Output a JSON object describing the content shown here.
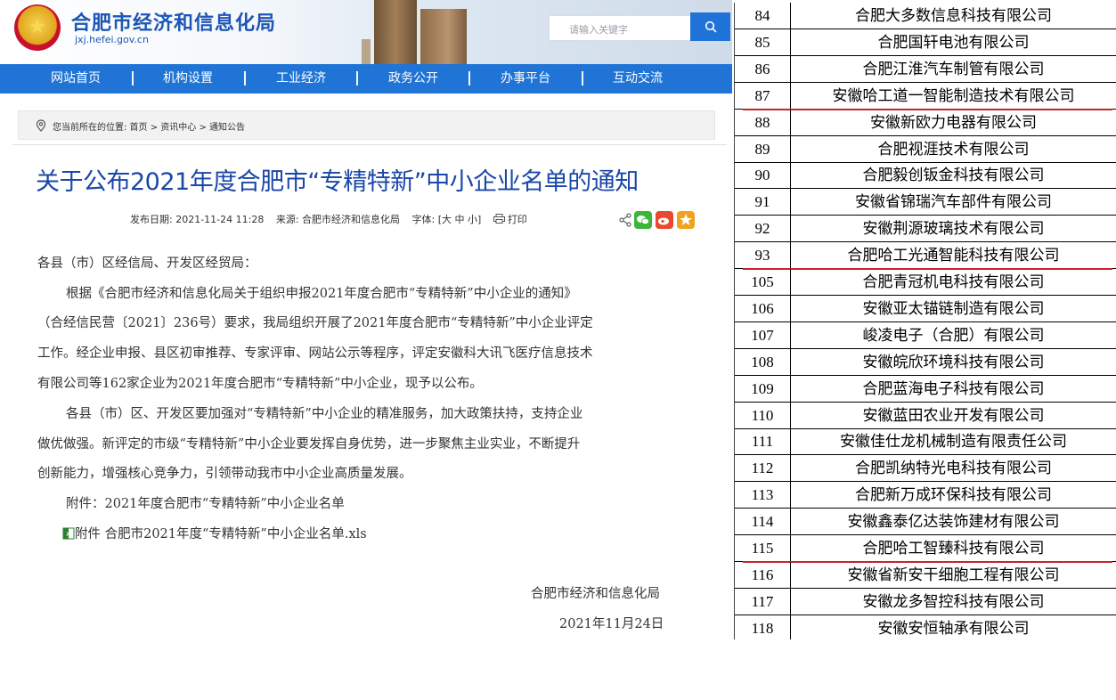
{
  "header": {
    "site_title": "合肥市经济和信息化局",
    "site_domain": "jxj.hefei.gov.cn",
    "search_placeholder": "请输入关键字"
  },
  "nav": {
    "items": [
      "网站首页",
      "机构设置",
      "工业经济",
      "政务公开",
      "办事平台",
      "互动交流"
    ]
  },
  "breadcrumb": "您当前所在的位置: 首页 > 资讯中心 > 通知公告",
  "article": {
    "title": "关于公布2021年度合肥市“专精特新”中小企业名单的通知",
    "publish_date": "发布日期: 2021-11-24 11:28",
    "source": "来源: 合肥市经济和信息化局",
    "font_size": "字体: [大 中 小]",
    "print_label": "打印",
    "salutation": "各县（市）区经信局、开发区经贸局：",
    "paragraph_1": [
      "根据《合肥市经济和信息化局关于组织申报2021年度合肥市“专精特新”中小企业的通知》",
      "（合经信民营〔2021〕236号）要求，我局组织开展了2021年度合肥市“专精特新”中小企业评定",
      "工作。经企业申报、县区初审推荐、专家评审、网站公示等程序，评定安徽科大讯飞医疗信息技术",
      "有限公司等162家企业为2021年度合肥市“专精特新”中小企业，现予以公布。"
    ],
    "paragraph_2": [
      "各县（市）区、开发区要加强对“专精特新”中小企业的精准服务，加大政策扶持，支持企业",
      "做优做强。新评定的市级“专精特新”中小企业要发挥自身优势，进一步聚焦主业实业，不断提升",
      "创新能力，增强核心竞争力，引领带动我市中小企业高质量发展。"
    ],
    "attachment_note": "附件：2021年度合肥市“专精特新”中小企业名单",
    "attachment_link": "附件 合肥市2021年度“专精特新”中小企业名单.xls",
    "signature": "合肥市经济和信息化局",
    "date": "2021年11月24日"
  },
  "table": {
    "rows": [
      {
        "no": "84",
        "name": "合肥大多数信息科技有限公司",
        "highlight": false
      },
      {
        "no": "85",
        "name": "合肥国轩电池有限公司",
        "highlight": false
      },
      {
        "no": "86",
        "name": "合肥江淮汽车制管有限公司",
        "highlight": false
      },
      {
        "no": "87",
        "name": "安徽哈工道一智能制造技术有限公司",
        "highlight": true
      },
      {
        "no": "88",
        "name": "安徽新欧力电器有限公司",
        "highlight": false
      },
      {
        "no": "89",
        "name": "合肥视涯技术有限公司",
        "highlight": false
      },
      {
        "no": "90",
        "name": "合肥毅创钣金科技有限公司",
        "highlight": false
      },
      {
        "no": "91",
        "name": "安徽省锦瑞汽车部件有限公司",
        "highlight": false
      },
      {
        "no": "92",
        "name": "安徽荆源玻璃技术有限公司",
        "highlight": false
      },
      {
        "no": "93",
        "name": "合肥哈工光通智能科技有限公司",
        "highlight": true
      },
      {
        "no": "105",
        "name": "合肥青冠机电科技有限公司",
        "highlight": false
      },
      {
        "no": "106",
        "name": "安徽亚太锚链制造有限公司",
        "highlight": false
      },
      {
        "no": "107",
        "name": "峻凌电子（合肥）有限公司",
        "highlight": false
      },
      {
        "no": "108",
        "name": "安徽皖欣环境科技有限公司",
        "highlight": false
      },
      {
        "no": "109",
        "name": "合肥蓝海电子科技有限公司",
        "highlight": false
      },
      {
        "no": "110",
        "name": "安徽蓝田农业开发有限公司",
        "highlight": false
      },
      {
        "no": "111",
        "name": "安徽佳仕龙机械制造有限责任公司",
        "highlight": false
      },
      {
        "no": "112",
        "name": "合肥凯纳特光电科技有限公司",
        "highlight": false
      },
      {
        "no": "113",
        "name": "合肥新万成环保科技有限公司",
        "highlight": false
      },
      {
        "no": "114",
        "name": "安徽鑫泰亿达装饰建材有限公司",
        "highlight": false
      },
      {
        "no": "115",
        "name": "合肥哈工智臻科技有限公司",
        "highlight": true
      },
      {
        "no": "116",
        "name": "安徽省新安干细胞工程有限公司",
        "highlight": false
      },
      {
        "no": "117",
        "name": "安徽龙多智控科技有限公司",
        "highlight": false
      },
      {
        "no": "118",
        "name": "安徽安恒轴承有限公司",
        "highlight": false
      }
    ]
  },
  "colors": {
    "brand_blue": "#1f74d6",
    "title_blue": "#1a47a8",
    "highlight_red": "#c7232e"
  },
  "icons": {
    "emblem": "national-emblem",
    "search": "search-icon",
    "pin": "location-pin-icon",
    "print": "printer-icon",
    "share": "share-icon",
    "wechat": "wechat-icon",
    "weibo": "weibo-icon",
    "favorite": "star-icon",
    "excel": "excel-file-icon"
  }
}
